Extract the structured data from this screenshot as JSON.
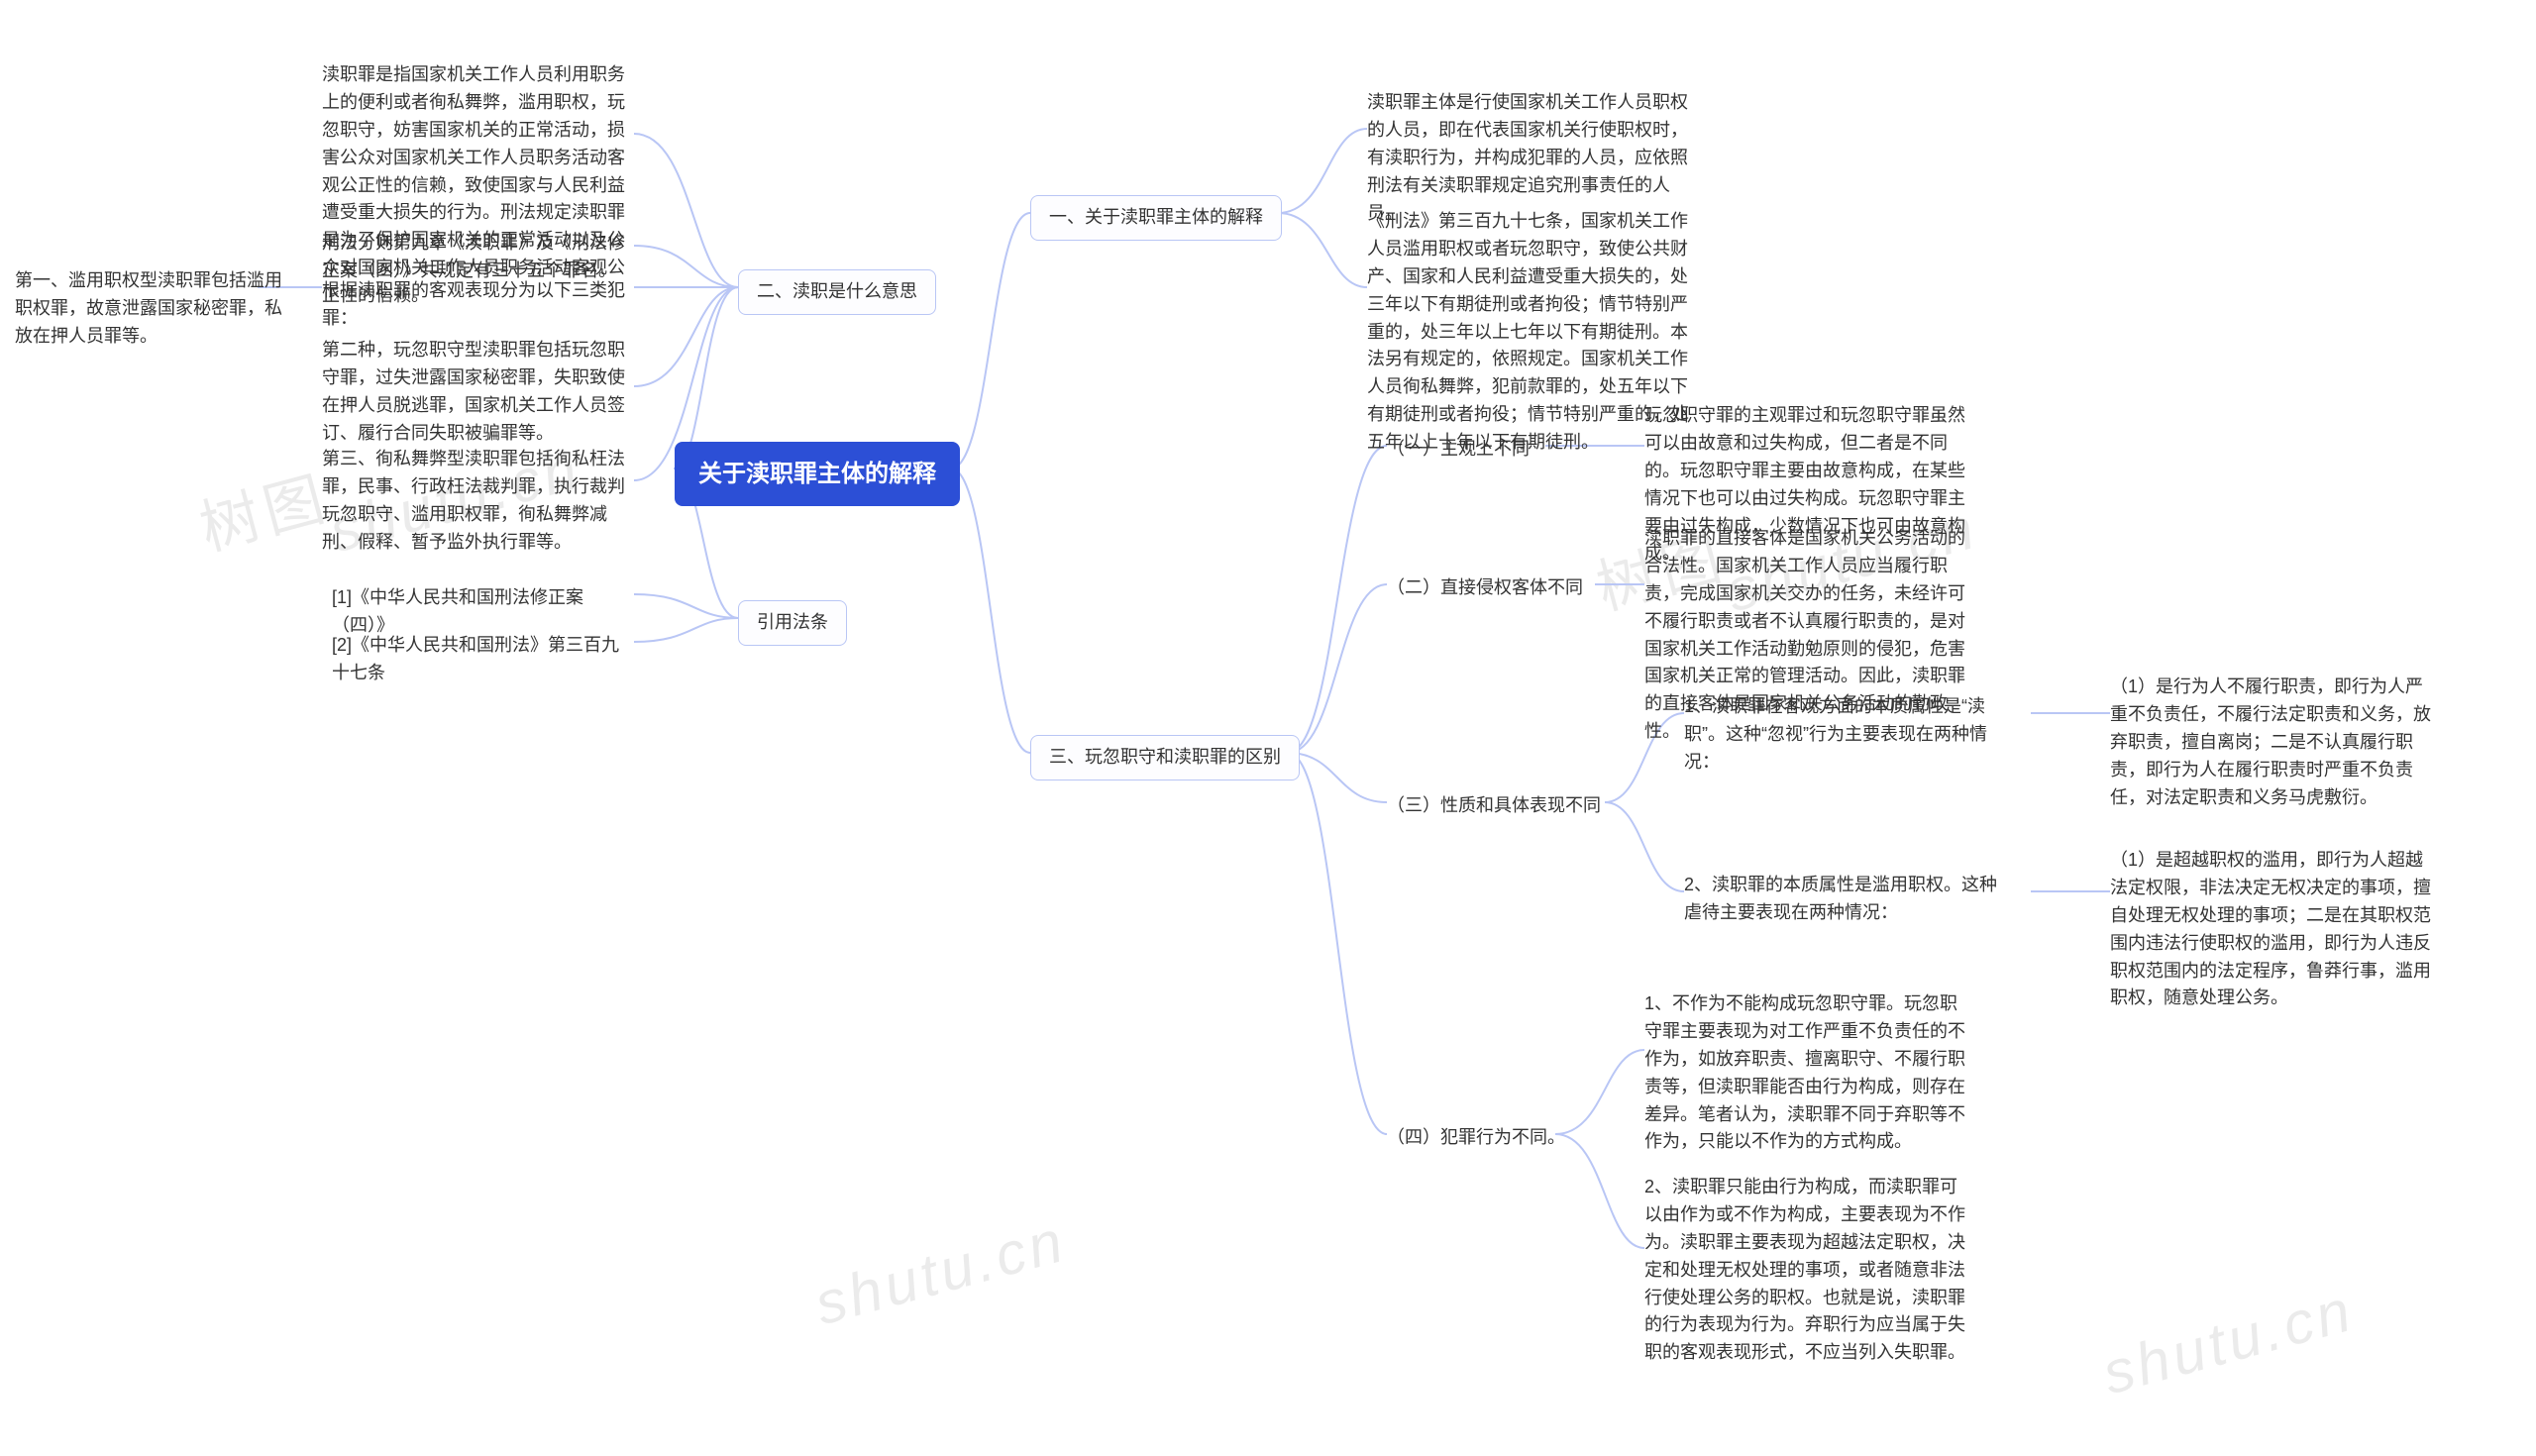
{
  "root": "关于渎职罪主体的解释",
  "right": {
    "b1": {
      "label": "一、关于渎职罪主体的解释",
      "leaves": [
        "渎职罪主体是行使国家机关工作人员职权的人员，即在代表国家机关行使职权时，有渎职行为，并构成犯罪的人员，应依照刑法有关渎职罪规定追究刑事责任的人员。",
        "《刑法》第三百九十七条，国家机关工作人员滥用职权或者玩忽职守，致使公共财产、国家和人民利益遭受重大损失的，处三年以下有期徒刑或者拘役；情节特别严重的，处三年以上七年以下有期徒刑。本法另有规定的，依照规定。国家机关工作人员徇私舞弊，犯前款罪的，处五年以下有期徒刑或者拘役；情节特别严重的，处五年以上十年以下有期徒刑。"
      ]
    },
    "b3": {
      "label": "三、玩忽职守和渎职罪的区别",
      "sub": {
        "s1": {
          "label": "（一）主观上不同",
          "leaf": "玩忽职守罪的主观罪过和玩忽职守罪虽然可以由故意和过失构成，但二者是不同的。玩忽职守罪主要由故意构成，在某些情况下也可以由过失构成。玩忽职守罪主要由过失构成，少数情况下也可由故意构成。"
        },
        "s2": {
          "label": "（二）直接侵权客体不同",
          "leaf": "渎职罪的直接客体是国家机关公务活动的合法性。国家机关工作人员应当履行职责，完成国家机关交办的任务，未经许可不履行职责或者不认真履行职责的，是对国家机关工作活动勤勉原则的侵犯，危害国家机关正常的管理活动。因此，渎职罪的直接客体是国家机关公务活动的勤政性。"
        },
        "s3": {
          "label": "（三）性质和具体表现不同",
          "mids": [
            {
              "text": "1、渎职罪在客观方面的本质属性是“渎职”。这种“忽视”行为主要表现在两种情况：",
              "leaf": "（1）是行为人不履行职责，即行为人严重不负责任，不履行法定职责和义务，放弃职责，擅自离岗；二是不认真履行职责，即行为人在履行职责时严重不负责任，对法定职责和义务马虎敷衍。"
            },
            {
              "text": "2、渎职罪的本质属性是滥用职权。这种虐待主要表现在两种情况：",
              "leaf": "（1）是超越职权的滥用，即行为人超越法定权限，非法决定无权决定的事项，擅自处理无权处理的事项；二是在其职权范围内违法行使职权的滥用，即行为人违反职权范围内的法定程序，鲁莽行事，滥用职权，随意处理公务。"
            }
          ]
        },
        "s4": {
          "label": "（四）犯罪行为不同。",
          "leaves": [
            "1、不作为不能构成玩忽职守罪。玩忽职守罪主要表现为对工作严重不负责任的不作为，如放弃职责、擅离职守、不履行职责等，但渎职罪能否由行为构成，则存在差异。笔者认为，渎职罪不同于弃职等不作为，只能以不作为的方式构成。",
            "2、渎职罪只能由行为构成，而渎职罪可以由作为或不作为构成，主要表现为不作为。渎职罪主要表现为超越法定职权，决定和处理无权处理的事项，或者随意非法行使处理公务的职权。也就是说，渎职罪的行为表现为行为。弃职行为应当属于失职的客观表现形式，不应当列入失职罪。"
          ]
        }
      }
    }
  },
  "left": {
    "b2": {
      "label": "二、渎职是什么意思",
      "leaves": {
        "l1": "渎职罪是指国家机关工作人员利用职务上的便利或者徇私舞弊，滥用职权，玩忽职守，妨害国家机关的正常活动，损害公众对国家机关工作人员职务活动客观公正性的信赖，致使国家与人民利益遭受重大损失的行为。刑法规定渎职罪是为了保护国家机关的正常活动以及公众对国家机关工作人员职务活动客观公正性的信赖。",
        "l2": "刑法分则第九章《渎职罪》及《刑法修正案（四）》共规定有三十五个罪名。",
        "l3": {
          "label": "根据渎职罪的客观表现分为以下三类犯罪：",
          "leaf": "第一、滥用职权型渎职罪包括滥用职权罪，故意泄露国家秘密罪，私放在押人员罪等。"
        },
        "l4": "第二种，玩忽职守型渎职罪包括玩忽职守罪，过失泄露国家秘密罪，失职致使在押人员脱逃罪，国家机关工作人员签订、履行合同失职被骗罪等。",
        "l5": "第三、徇私舞弊型渎职罪包括徇私枉法罪，民事、行政枉法裁判罪，执行裁判玩忽职守、滥用职权罪，徇私舞弊减刑、假释、暂予监外执行罪等。"
      }
    },
    "bref": {
      "label": "引用法条",
      "leaves": [
        "[1]《中华人民共和国刑法修正案（四）》",
        "[2]《中华人民共和国刑法》第三百九十七条"
      ]
    }
  },
  "watermark": "树图 shutu.cn",
  "watermark_cn": "树图",
  "watermark_en": "shutu.cn",
  "colors": {
    "line": "#b9c6f5",
    "root_bg": "#2c4fd6"
  },
  "chart_data": {
    "type": "mindmap",
    "title": "关于渎职罪主体的解释",
    "orientation": "bidirectional",
    "root": "关于渎职罪主体的解释",
    "left_branches": [
      "二、渎职是什么意思",
      "引用法条"
    ],
    "right_branches": [
      "一、关于渎职罪主体的解释",
      "三、玩忽职守和渎职罪的区别"
    ]
  }
}
